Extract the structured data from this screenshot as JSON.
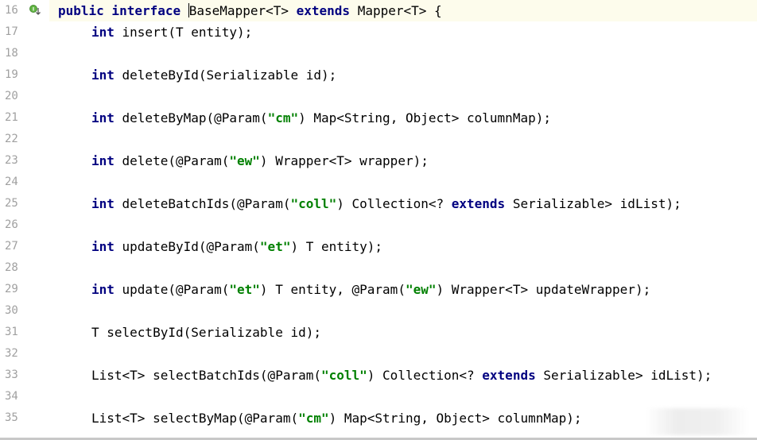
{
  "gutter": {
    "line_numbers": [
      "16",
      "17",
      "18",
      "19",
      "20",
      "21",
      "22",
      "23",
      "24",
      "25",
      "26",
      "27",
      "28",
      "29",
      "30",
      "31",
      "32",
      "33",
      "34",
      "35"
    ],
    "icons": [
      {
        "line": "16",
        "icon": "implemented-interface-icon"
      }
    ]
  },
  "code": {
    "lines": [
      [
        {
          "t": "public interface ",
          "c": "kw"
        },
        {
          "t": "",
          "c": "caret"
        },
        {
          "t": "BaseMapper<T> ",
          "c": "plain"
        },
        {
          "t": "extends ",
          "c": "kw"
        },
        {
          "t": "Mapper<T> {",
          "c": "plain"
        }
      ],
      [
        {
          "t": "int ",
          "c": "kw"
        },
        {
          "t": "insert(T entity);",
          "c": "plain"
        }
      ],
      [],
      [
        {
          "t": "int ",
          "c": "kw"
        },
        {
          "t": "deleteById(Serializable id);",
          "c": "plain"
        }
      ],
      [],
      [
        {
          "t": "int ",
          "c": "kw"
        },
        {
          "t": "deleteByMap(@Param(",
          "c": "plain"
        },
        {
          "t": "\"cm\"",
          "c": "str"
        },
        {
          "t": ") Map<String, Object> columnMap);",
          "c": "plain"
        }
      ],
      [],
      [
        {
          "t": "int ",
          "c": "kw"
        },
        {
          "t": "delete(@Param(",
          "c": "plain"
        },
        {
          "t": "\"ew\"",
          "c": "str"
        },
        {
          "t": ") Wrapper<T> wrapper);",
          "c": "plain"
        }
      ],
      [],
      [
        {
          "t": "int ",
          "c": "kw"
        },
        {
          "t": "deleteBatchIds(@Param(",
          "c": "plain"
        },
        {
          "t": "\"coll\"",
          "c": "str"
        },
        {
          "t": ") Collection<? ",
          "c": "plain"
        },
        {
          "t": "extends ",
          "c": "kw"
        },
        {
          "t": "Serializable> idList);",
          "c": "plain"
        }
      ],
      [],
      [
        {
          "t": "int ",
          "c": "kw"
        },
        {
          "t": "updateById(@Param(",
          "c": "plain"
        },
        {
          "t": "\"et\"",
          "c": "str"
        },
        {
          "t": ") T entity);",
          "c": "plain"
        }
      ],
      [],
      [
        {
          "t": "int ",
          "c": "kw"
        },
        {
          "t": "update(@Param(",
          "c": "plain"
        },
        {
          "t": "\"et\"",
          "c": "str"
        },
        {
          "t": ") T entity, @Param(",
          "c": "plain"
        },
        {
          "t": "\"ew\"",
          "c": "str"
        },
        {
          "t": ") Wrapper<T> updateWrapper);",
          "c": "plain"
        }
      ],
      [],
      [
        {
          "t": "T selectById(Serializable id);",
          "c": "plain"
        }
      ],
      [],
      [
        {
          "t": "List<T> selectBatchIds(@Param(",
          "c": "plain"
        },
        {
          "t": "\"coll\"",
          "c": "str"
        },
        {
          "t": ") Collection<? ",
          "c": "plain"
        },
        {
          "t": "extends ",
          "c": "kw"
        },
        {
          "t": "Serializable> idList);",
          "c": "plain"
        }
      ],
      [],
      [
        {
          "t": "List<T> selectByMap(@Param(",
          "c": "plain"
        },
        {
          "t": "\"cm\"",
          "c": "str"
        },
        {
          "t": ") Map<String, Object> columnMap);",
          "c": "plain"
        }
      ]
    ]
  },
  "colors": {
    "keyword": "#000080",
    "string": "#008000",
    "line_number": "#a0a0a0",
    "current_line_bg": "#fdfcec"
  }
}
